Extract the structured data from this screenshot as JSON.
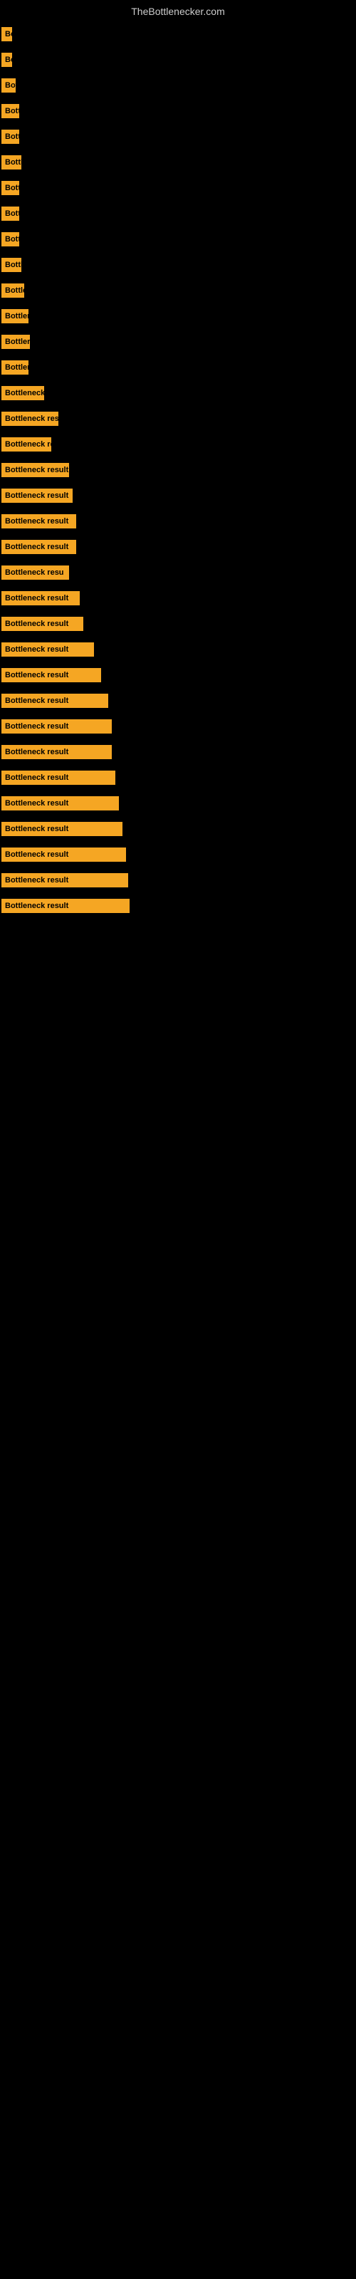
{
  "site": {
    "title": "TheBottlenecker.com"
  },
  "items": [
    {
      "label": "Bo",
      "width": 15
    },
    {
      "label": "Bo",
      "width": 15
    },
    {
      "label": "Bot",
      "width": 20
    },
    {
      "label": "Bott",
      "width": 25
    },
    {
      "label": "Bott",
      "width": 25
    },
    {
      "label": "Bottl",
      "width": 28
    },
    {
      "label": "Bott",
      "width": 25
    },
    {
      "label": "Bott",
      "width": 25
    },
    {
      "label": "Bott",
      "width": 25
    },
    {
      "label": "Bottl",
      "width": 28
    },
    {
      "label": "Bottle",
      "width": 32
    },
    {
      "label": "Bottlen",
      "width": 38
    },
    {
      "label": "Bottler",
      "width": 40
    },
    {
      "label": "Bottlen",
      "width": 38
    },
    {
      "label": "Bottleneck r",
      "width": 60
    },
    {
      "label": "Bottleneck resu",
      "width": 80
    },
    {
      "label": "Bottleneck re",
      "width": 70
    },
    {
      "label": "Bottleneck result",
      "width": 95
    },
    {
      "label": "Bottleneck result",
      "width": 100
    },
    {
      "label": "Bottleneck result",
      "width": 105
    },
    {
      "label": "Bottleneck result",
      "width": 105
    },
    {
      "label": "Bottleneck resu",
      "width": 95
    },
    {
      "label": "Bottleneck result",
      "width": 110
    },
    {
      "label": "Bottleneck result",
      "width": 115
    },
    {
      "label": "Bottleneck result",
      "width": 130
    },
    {
      "label": "Bottleneck result",
      "width": 140
    },
    {
      "label": "Bottleneck result",
      "width": 150
    },
    {
      "label": "Bottleneck result",
      "width": 155
    },
    {
      "label": "Bottleneck result",
      "width": 155
    },
    {
      "label": "Bottleneck result",
      "width": 160
    },
    {
      "label": "Bottleneck result",
      "width": 165
    },
    {
      "label": "Bottleneck result",
      "width": 170
    },
    {
      "label": "Bottleneck result",
      "width": 175
    },
    {
      "label": "Bottleneck result",
      "width": 178
    },
    {
      "label": "Bottleneck result",
      "width": 180
    }
  ]
}
